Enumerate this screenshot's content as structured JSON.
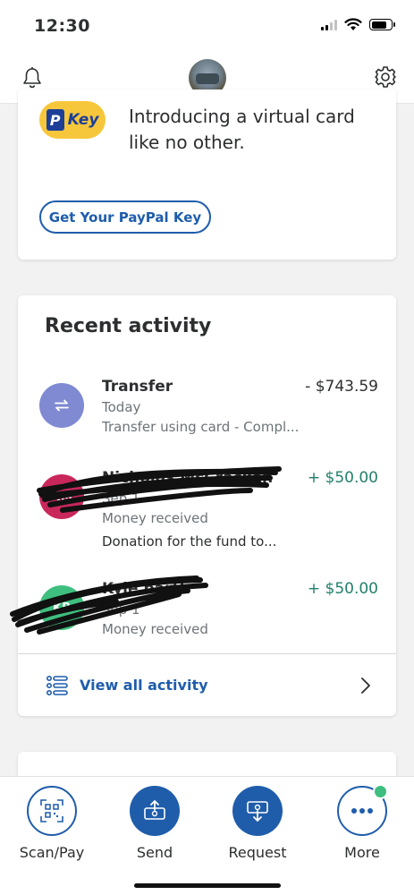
{
  "status_bar": {
    "time": "12:30"
  },
  "promo": {
    "badge_text": "Key",
    "headline": "Introducing a virtual card like no other.",
    "button_label": "Get Your PayPal Key"
  },
  "activity": {
    "title": "Recent activity",
    "transactions": [
      {
        "name": "Transfer",
        "amount": "- $743.59",
        "date": "Today",
        "description": "Transfer using card - Compl...",
        "avatar_color": "#7f8ad2"
      },
      {
        "name": "Nicholas McCracken",
        "amount": "+ $50.00",
        "date": "Sep 1",
        "description": "Money received",
        "note": "Donation for the fund to...",
        "avatar_color": "#c8275b"
      },
      {
        "name": "Kyle barth",
        "amount": "+ $50.00",
        "date": "Sep 1",
        "description": "Money received",
        "avatar_color": "#3fbf7f"
      }
    ],
    "view_all_label": "View all activity"
  },
  "tabs": [
    {
      "label": "Scan/Pay",
      "icon": "qr-code-icon"
    },
    {
      "label": "Send",
      "icon": "send-money-icon"
    },
    {
      "label": "Request",
      "icon": "request-money-icon"
    },
    {
      "label": "More",
      "icon": "more-dots-icon"
    }
  ],
  "colors": {
    "brand_blue": "#1f5dab",
    "positive_green": "#23806c",
    "key_yellow": "#f7c73b"
  }
}
